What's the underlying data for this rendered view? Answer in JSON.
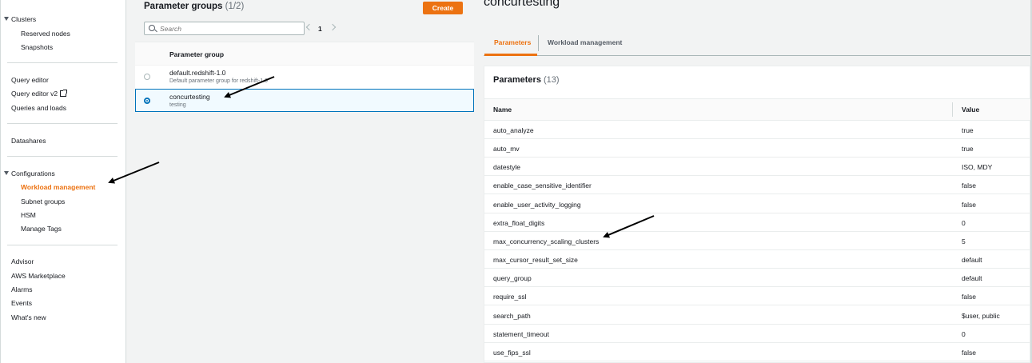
{
  "sidebar": {
    "groups": [
      {
        "label": "Clusters",
        "items": [
          "Reserved nodes",
          "Snapshots"
        ]
      },
      {
        "label": "Configurations",
        "items": [
          "Workload management",
          "Subnet groups",
          "HSM",
          "Manage Tags"
        ]
      }
    ],
    "query": [
      "Query editor",
      "Query editor v2",
      "Queries and loads"
    ],
    "datashares": "Datashares",
    "bottom": [
      "Advisor",
      "AWS Marketplace",
      "Alarms",
      "Events",
      "What's new"
    ],
    "active_item": "Workload management"
  },
  "parameter_groups": {
    "title": "Parameter groups",
    "count": "(1/2)",
    "create_label": "Create",
    "search_placeholder": "Search",
    "page": "1",
    "column_header": "Parameter group",
    "rows": [
      {
        "name": "default.redshift-1.0",
        "description": "Default parameter group for redshift-1.0",
        "selected": false
      },
      {
        "name": "concurtesting",
        "description": "testing",
        "selected": true
      }
    ]
  },
  "detail": {
    "title": "concurtesting",
    "tabs": [
      "Parameters",
      "Workload management"
    ],
    "active_tab": "Parameters",
    "params_title": "Parameters",
    "params_count": "(13)",
    "columns": [
      "Name",
      "Value"
    ],
    "params": [
      {
        "name": "auto_analyze",
        "value": "true"
      },
      {
        "name": "auto_mv",
        "value": "true"
      },
      {
        "name": "datestyle",
        "value": "ISO, MDY"
      },
      {
        "name": "enable_case_sensitive_identifier",
        "value": "false"
      },
      {
        "name": "enable_user_activity_logging",
        "value": "false"
      },
      {
        "name": "extra_float_digits",
        "value": "0"
      },
      {
        "name": "max_concurrency_scaling_clusters",
        "value": "5"
      },
      {
        "name": "max_cursor_result_set_size",
        "value": "default"
      },
      {
        "name": "query_group",
        "value": "default"
      },
      {
        "name": "require_ssl",
        "value": "false"
      },
      {
        "name": "search_path",
        "value": "$user, public"
      },
      {
        "name": "statement_timeout",
        "value": "0"
      },
      {
        "name": "use_fips_ssl",
        "value": "false"
      }
    ]
  },
  "colors": {
    "accent": "#ec7211",
    "selected": "#0073bb",
    "selected_bg": "#f1faff"
  }
}
